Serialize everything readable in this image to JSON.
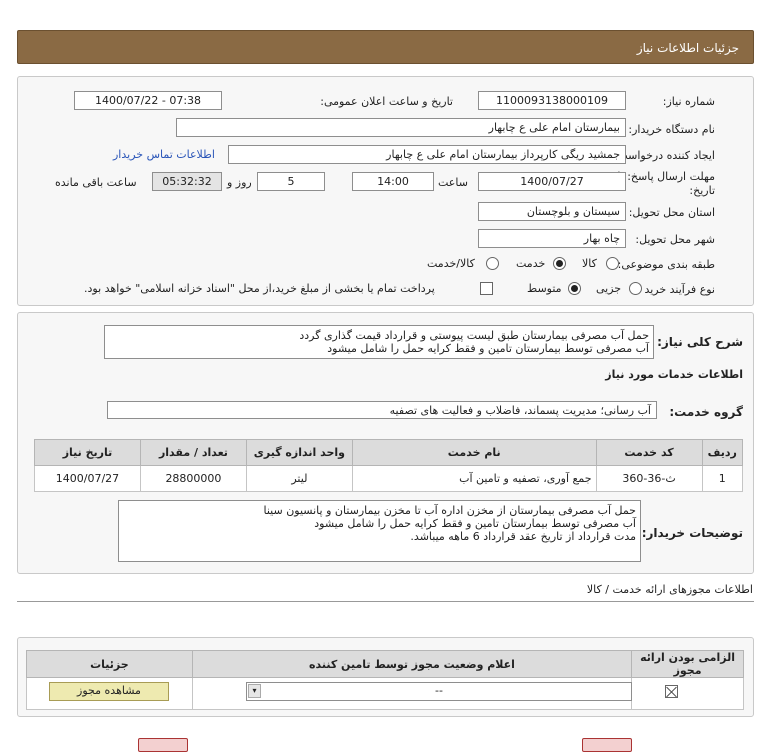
{
  "header": {
    "title": "جزئیات اطلاعات نیاز"
  },
  "form": {
    "need_number_label": "شماره نیاز:",
    "need_number": "1100093138000109",
    "announce_label": "تاریخ و ساعت اعلان عمومی:",
    "announce_value": "1400/07/22 - 07:38",
    "buyer_org_label": "نام دستگاه خریدار:",
    "buyer_org": "بیمارستان امام علی  ع  چابهار",
    "requester_label": "ایجاد کننده درخواست:",
    "requester": "جمشید ریگی کارپرداز بیمارستان امام علی  ع  چابهار",
    "contact_link": "اطلاعات تماس خریدار",
    "deadline_label_1": "مهلت ارسال پاسخ: تا",
    "deadline_label_2": "تاریخ:",
    "deadline_date": "1400/07/27",
    "time_label": "ساعت",
    "deadline_time": "14:00",
    "days_value": "5",
    "days_label": "روز و",
    "remaining_time": "05:32:32",
    "remaining_label": "ساعت باقی مانده",
    "province_label": "استان محل تحویل:",
    "province": "سیستان و بلوچستان",
    "city_label": "شهر محل تحویل:",
    "city": "چاه بهار",
    "category_label": "طبقه بندی موضوعی:",
    "category_options": [
      "کالا",
      "خدمت",
      "کالا/خدمت"
    ],
    "category_selected": "خدمت",
    "process_label": "نوع فرآیند خرید :",
    "process_options": [
      "جزیی",
      "متوسط"
    ],
    "process_selected": "متوسط",
    "payment_note": "پرداخت تمام یا بخشی از مبلغ خرید،از محل \"اسناد خزانه اسلامی\" خواهد بود."
  },
  "summary": {
    "label": "شرح کلی نیاز:",
    "lines": [
      "حمل آب مصرفی بیمارستان طبق لیست پیوستی و قرارداد قیمت گذاری گردد",
      "آب مصرفی توسط بیمارستان تامین و فقط کرایه حمل را شامل میشود"
    ]
  },
  "services": {
    "section_title": "اطلاعات خدمات مورد نیاز",
    "group_label": "گروه خدمت:",
    "group_value": "آب رسانی؛ مدیریت پسماند، فاضلاب و فعالیت های تصفیه",
    "columns": [
      "ردیف",
      "کد خدمت",
      "نام خدمت",
      "واحد اندازه گیری",
      "تعداد / مقدار",
      "تاریخ نیاز"
    ],
    "rows": [
      {
        "row": "1",
        "code": "ث-36-360",
        "name": "جمع آوری، تصفیه و تامین آب",
        "unit": "لیتر",
        "qty": "28800000",
        "date": "1400/07/27"
      }
    ]
  },
  "buyer_notes": {
    "label": "توضیحات خریدار:",
    "lines": [
      "حمل آب مصرفی بیمارستان از مخزن اداره آب تا مخزن بیمارستان و پانسیون سینا",
      "آب مصرفی توسط بیمارستان تامین و فقط کرایه حمل را شامل میشود",
      "مدت قرارداد از تاریخ عقد قرارداد 6 ماهه میباشد."
    ]
  },
  "permits": {
    "section_title": "اطلاعات مجوزهای ارائه خدمت / کالا",
    "columns": [
      "الزامی بودن ارائه مجوز",
      "اعلام وضعیت مجوز توسط تامین کننده",
      "جزئیات"
    ],
    "status_value": "--",
    "view_button": "مشاهده مجوز"
  },
  "colors": {
    "title_bar": "#8a6a44",
    "link": "#2a55b8",
    "button": "#eeeab0"
  }
}
